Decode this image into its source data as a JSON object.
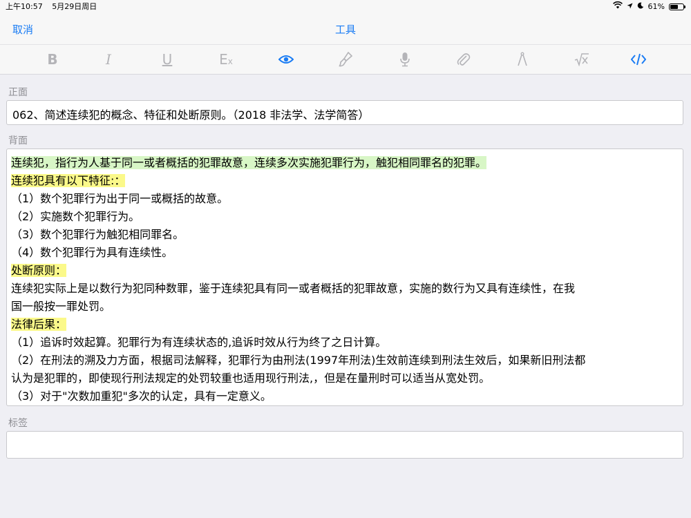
{
  "status_bar": {
    "time": "上午10:57",
    "date": "5月29日周日",
    "battery": "61%",
    "battery_level": 0.61
  },
  "nav": {
    "cancel_label": "取消",
    "title": "工具",
    "accent": "#1a7cf4"
  },
  "toolbar": {
    "bold_label": "B",
    "italic_label": "I",
    "underline_label": "U",
    "clear_format_label": "E",
    "clear_format_sub": "x",
    "icons": [
      "bold-icon",
      "italic-icon",
      "underline-icon",
      "clear-format-icon",
      "eye-icon",
      "brush-icon",
      "microphone-icon",
      "paperclip-icon",
      "compass-icon",
      "sqrt-x-icon",
      "code-icon"
    ],
    "active_color": "#1a7cf4",
    "inactive_color": "#b4b4b8"
  },
  "front": {
    "label": "正面",
    "text": "062、简述连续犯的概念、特征和处断原则。（2018 非法学、法学简答）"
  },
  "back": {
    "label": "背面",
    "lines": [
      {
        "text": "连续犯，指行为人基于同一或者概括的犯罪故意，连续多次实施犯罪行为，触犯相同罪名的犯罪。",
        "highlight": "green"
      },
      {
        "text": "连续犯具有以下特征:：",
        "highlight": "yellow"
      },
      {
        "text": "（1）数个犯罪行为出于同一或概括的故意。",
        "highlight": ""
      },
      {
        "text": "（2）实施数个犯罪行为。",
        "highlight": ""
      },
      {
        "text": "（3）数个犯罪行为触犯相同罪名。",
        "highlight": ""
      },
      {
        "text": "（4）数个犯罪行为具有连续性。",
        "highlight": ""
      },
      {
        "text": "处断原则：",
        "highlight": "yellow"
      },
      {
        "text": "连续犯实际上是以数行为犯同种数罪，鉴于连续犯具有同一或者概括的犯罪故意，实施的数行为又具有连续性，在我",
        "highlight": ""
      },
      {
        "text": "国一般按一罪处罚。",
        "highlight": ""
      },
      {
        "text": "法律后果：",
        "highlight": "yellow"
      },
      {
        "text": "（1）追诉时效起算。犯罪行为有连续状态的,追诉时效从行为终了之日计算。",
        "highlight": ""
      },
      {
        "text": "（2）在刑法的溯及力方面，根据司法解释，犯罪行为由刑法(1997年刑法)生效前连续到刑法生效后，如果新旧刑法都",
        "highlight": ""
      },
      {
        "text": "认为是犯罪的，即使现行刑法规定的处罚较重也适用现行刑法,，但是在量刑时可以适当从宽处罚。",
        "highlight": ""
      },
      {
        "text": "（3）对于\"次数加重犯\"多次的认定，具有一定意义。",
        "highlight": ""
      }
    ],
    "highlight_green": "#d8f6c6",
    "highlight_yellow": "#fbf98a"
  },
  "tags": {
    "label": "标签",
    "value": ""
  }
}
